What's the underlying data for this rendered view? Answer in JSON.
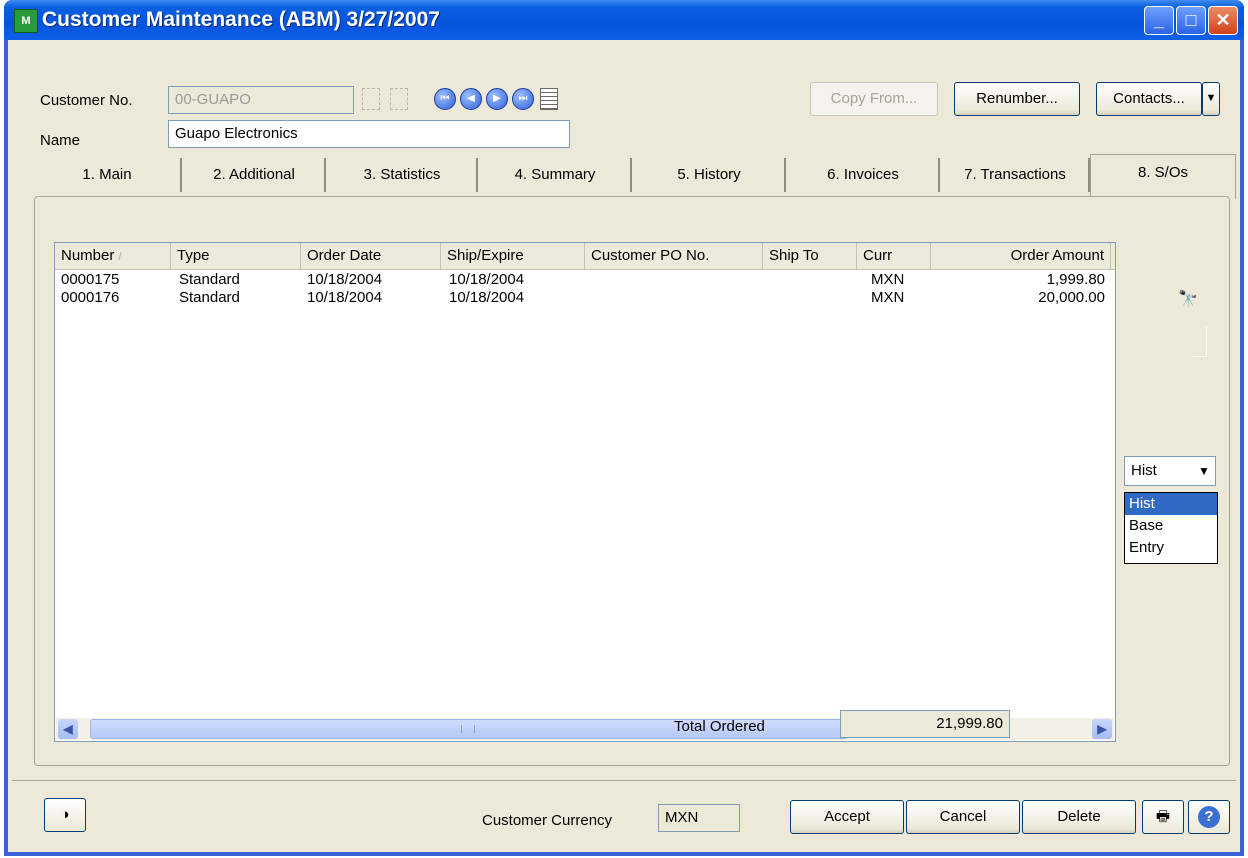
{
  "window": {
    "title": "Customer Maintenance (ABM) 3/27/2007",
    "app_icon_text": "M"
  },
  "header": {
    "customer_no_label": "Customer No.",
    "customer_no_value": "00-GUAPO",
    "name_label": "Name",
    "name_value": "Guapo Electronics",
    "copy_from_label": "Copy From...",
    "renumber_label": "Renumber...",
    "contacts_label": "Contacts..."
  },
  "tabs": [
    {
      "label": "1. Main"
    },
    {
      "label": "2. Additional"
    },
    {
      "label": "3. Statistics"
    },
    {
      "label": "4. Summary"
    },
    {
      "label": "5. History"
    },
    {
      "label": "6. Invoices"
    },
    {
      "label": "7. Transactions"
    },
    {
      "label": "8. S/Os"
    }
  ],
  "grid": {
    "columns": [
      "Number",
      "Type",
      "Order Date",
      "Ship/Expire",
      "Customer PO No.",
      "Ship To",
      "Curr",
      "Order Amount"
    ],
    "rows": [
      {
        "number": "0000175",
        "type": "Standard",
        "order_date": "10/18/2004",
        "ship_expire": "10/18/2004",
        "po": "",
        "ship_to": "",
        "curr": "MXN",
        "amount": "1,999.80"
      },
      {
        "number": "0000176",
        "type": "Standard",
        "order_date": "10/18/2004",
        "ship_expire": "10/18/2004",
        "po": "",
        "ship_to": "",
        "curr": "MXN",
        "amount": "20,000.00"
      }
    ]
  },
  "currency_combo": {
    "value": "Hist",
    "options": [
      "Hist",
      "Base",
      "Entry"
    ]
  },
  "totals": {
    "label": "Total Ordered",
    "value": "21,999.80"
  },
  "footer": {
    "customer_currency_label": "Customer Currency",
    "customer_currency_value": "MXN",
    "accept_label": "Accept",
    "cancel_label": "Cancel",
    "delete_label": "Delete"
  },
  "colors": {
    "titlebar": "#0554dc",
    "face": "#ece9d8",
    "selection": "#316ac5"
  }
}
